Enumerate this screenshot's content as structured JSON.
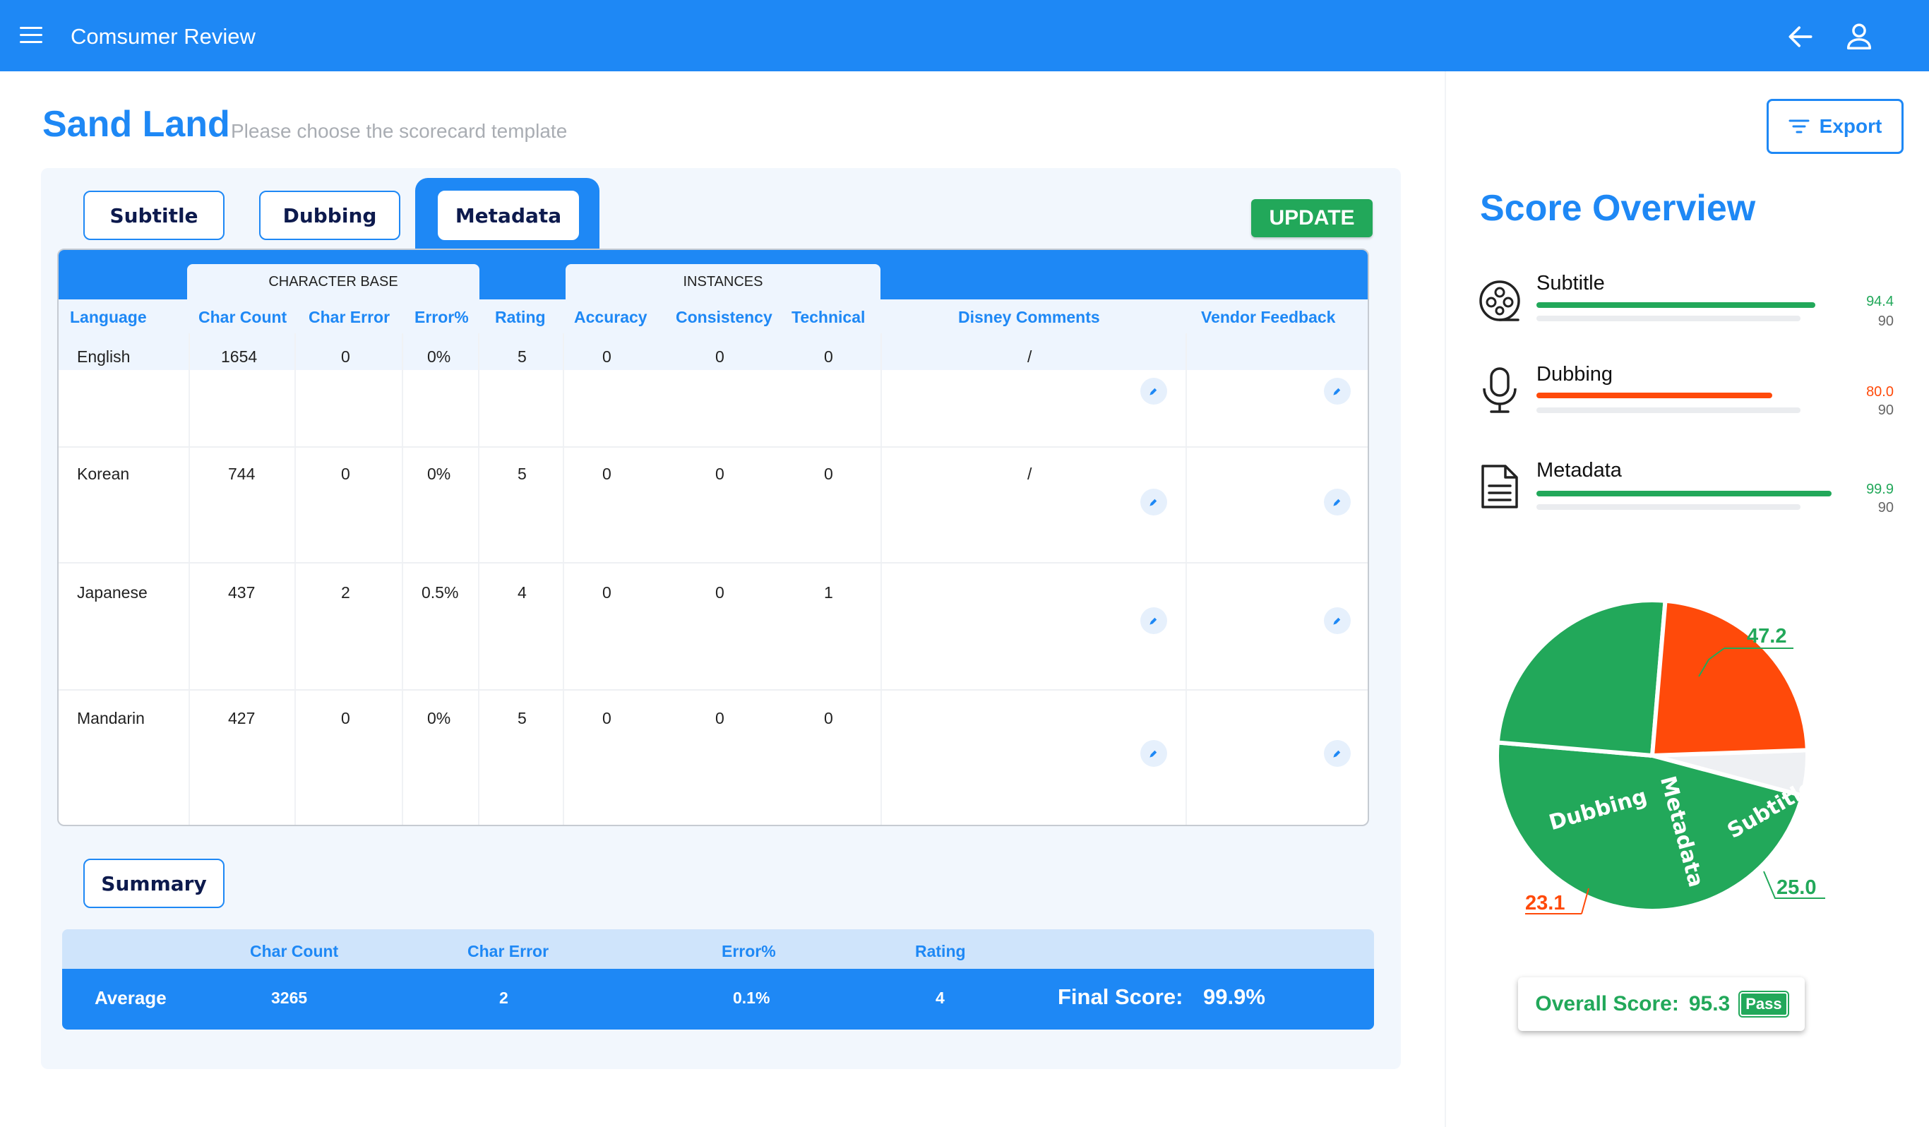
{
  "app": {
    "title": "Comsumer Review"
  },
  "page": {
    "title": "Sand Land",
    "subtitle": "Please choose the scorecard template"
  },
  "tabs": [
    "Subtitle",
    "Dubbing",
    "Metadata"
  ],
  "active_tab": "Metadata",
  "update_label": "UPDATE",
  "table": {
    "groups": {
      "character_base": "CHARACTER BASE",
      "instances": "INSTANCES"
    },
    "headers": [
      "Language",
      "Char Count",
      "Char Error",
      "Error%",
      "Rating",
      "Accuracy",
      "Consistency",
      "Technical",
      "Disney Comments",
      "Vendor Feedback"
    ],
    "rows": [
      {
        "language": "English",
        "char_count": "1654",
        "char_error": "0",
        "error_pct": "0%",
        "rating": "5",
        "accuracy": "0",
        "consistency": "0",
        "technical": "0",
        "disney_comments": "/",
        "vendor_feedback": ""
      },
      {
        "language": "Korean",
        "char_count": "744",
        "char_error": "0",
        "error_pct": "0%",
        "rating": "5",
        "accuracy": "0",
        "consistency": "0",
        "technical": "0",
        "disney_comments": "/",
        "vendor_feedback": ""
      },
      {
        "language": "Japanese",
        "char_count": "437",
        "char_error": "2",
        "error_pct": "0.5%",
        "rating": "4",
        "accuracy": "0",
        "consistency": "0",
        "technical": "1",
        "disney_comments": "",
        "vendor_feedback": ""
      },
      {
        "language": "Mandarin",
        "char_count": "427",
        "char_error": "0",
        "error_pct": "0%",
        "rating": "5",
        "accuracy": "0",
        "consistency": "0",
        "technical": "0",
        "disney_comments": "",
        "vendor_feedback": ""
      }
    ]
  },
  "summary": {
    "button_label": "Summary",
    "headers": [
      "Char Count",
      "Char Error",
      "Error%",
      "Rating"
    ],
    "row": {
      "label": "Average",
      "char_count": "3265",
      "char_error": "2",
      "error_pct": "0.1%",
      "rating": "4",
      "final_score_label": "Final Score:",
      "final_score": "99.9%"
    }
  },
  "export_label": "Export",
  "score_overview": {
    "title": "Score Overview",
    "items": [
      {
        "label": "Subtitle",
        "icon": "film-reel-icon",
        "score": "94.4",
        "target": "90",
        "score_value": 94.4,
        "color": "#22a85a"
      },
      {
        "label": "Dubbing",
        "icon": "microphone-icon",
        "score": "80.0",
        "target": "90",
        "score_value": 80.0,
        "color": "#ff4a0a"
      },
      {
        "label": "Metadata",
        "icon": "document-icon",
        "score": "99.9",
        "target": "90",
        "score_value": 99.9,
        "color": "#22a85a"
      }
    ],
    "overall_label": "Overall Score:",
    "overall_value": "95.3",
    "pass_label": "Pass"
  },
  "colors": {
    "primary": "#1e88f5",
    "green": "#22a85a",
    "orange": "#ff4a0a",
    "gray": "#eef0f3"
  },
  "chart_data": {
    "type": "pie",
    "slices": [
      {
        "name": "Subtitle",
        "value": 47.2,
        "label": "47.2",
        "color": "#22a85a"
      },
      {
        "name": "Metadata",
        "value": 25.0,
        "label": "25.0",
        "color": "#22a85a"
      },
      {
        "name": "Dubbing",
        "value": 23.1,
        "label": "23.1",
        "color": "#ff4a0a"
      },
      {
        "name": "remainder",
        "value": 4.7,
        "label": "",
        "color": "#eef0f3"
      }
    ]
  }
}
